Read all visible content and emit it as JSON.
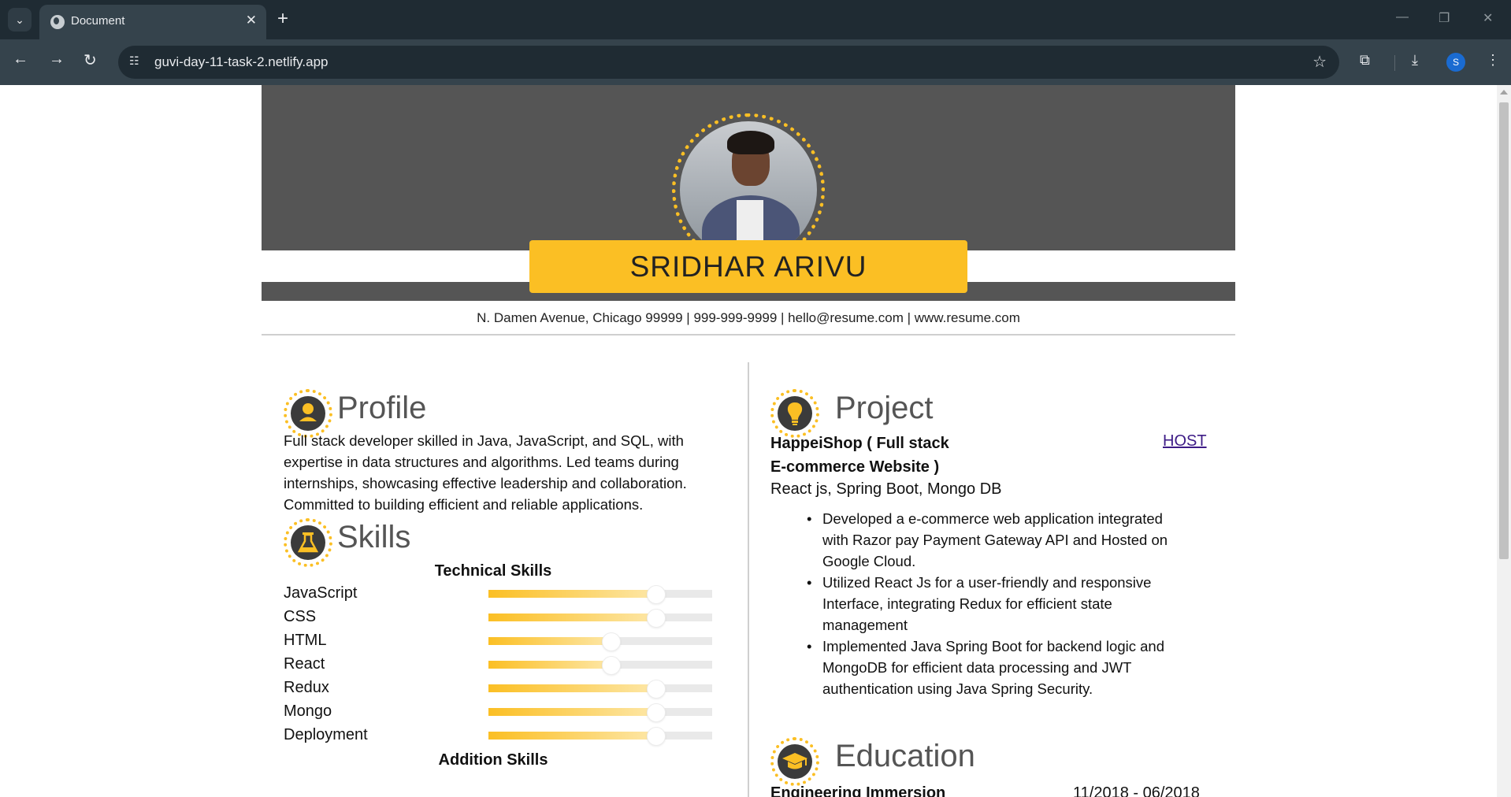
{
  "browser": {
    "tab_title": "Document",
    "tab_close": "✕",
    "new_tab": "+",
    "url": "guvi-day-11-task-2.netlify.app",
    "profile_initial": "S",
    "window_controls": [
      "—",
      "❐",
      "✕"
    ]
  },
  "resume": {
    "name": "SRIDHAR ARIVU",
    "contact": "N. Damen Avenue, Chicago 99999 | 999-999-9999 | hello@resume.com | www.resume.com",
    "profile": {
      "title": "Profile",
      "lines": [
        "Full stack developer skilled in Java, JavaScript, and SQL, with",
        "expertise in data structures and algorithms. Led teams during",
        "internships, showcasing effective leadership and collaboration.",
        "Committed to building efficient and reliable applications."
      ]
    },
    "skills": {
      "title": "Skills",
      "technical_heading": "Technical Skills",
      "technical": [
        {
          "name": "JavaScript",
          "level": 0.75
        },
        {
          "name": "CSS",
          "level": 0.75
        },
        {
          "name": "HTML",
          "level": 0.55
        },
        {
          "name": "React",
          "level": 0.55
        },
        {
          "name": "Redux",
          "level": 0.75
        },
        {
          "name": "Mongo",
          "level": 0.75
        },
        {
          "name": "Deployment",
          "level": 0.75
        }
      ],
      "addition_heading": "Addition Skills"
    },
    "project": {
      "title": "Project",
      "name_line1": "HappeiShop ( Full stack",
      "name_line2": "E-commerce Website )",
      "host_label": "HOST",
      "tech": "React js, Spring Boot, Mongo DB",
      "bullets": [
        [
          "Developed a e-commerce web application integrated",
          "with Razor pay Payment Gateway API and Hosted on",
          "Google Cloud."
        ],
        [
          "Utilized React Js for a user-friendly and responsive",
          "Interface, integrating Redux for efficient state",
          "management"
        ],
        [
          "Implemented Java Spring Boot for backend logic and",
          "MongoDB for efficient data processing and JWT",
          "authentication using Java Spring Security."
        ]
      ]
    },
    "education": {
      "title": "Education",
      "program": "Engineering Immersion",
      "dates": "11/2018 - 06/2018"
    }
  }
}
